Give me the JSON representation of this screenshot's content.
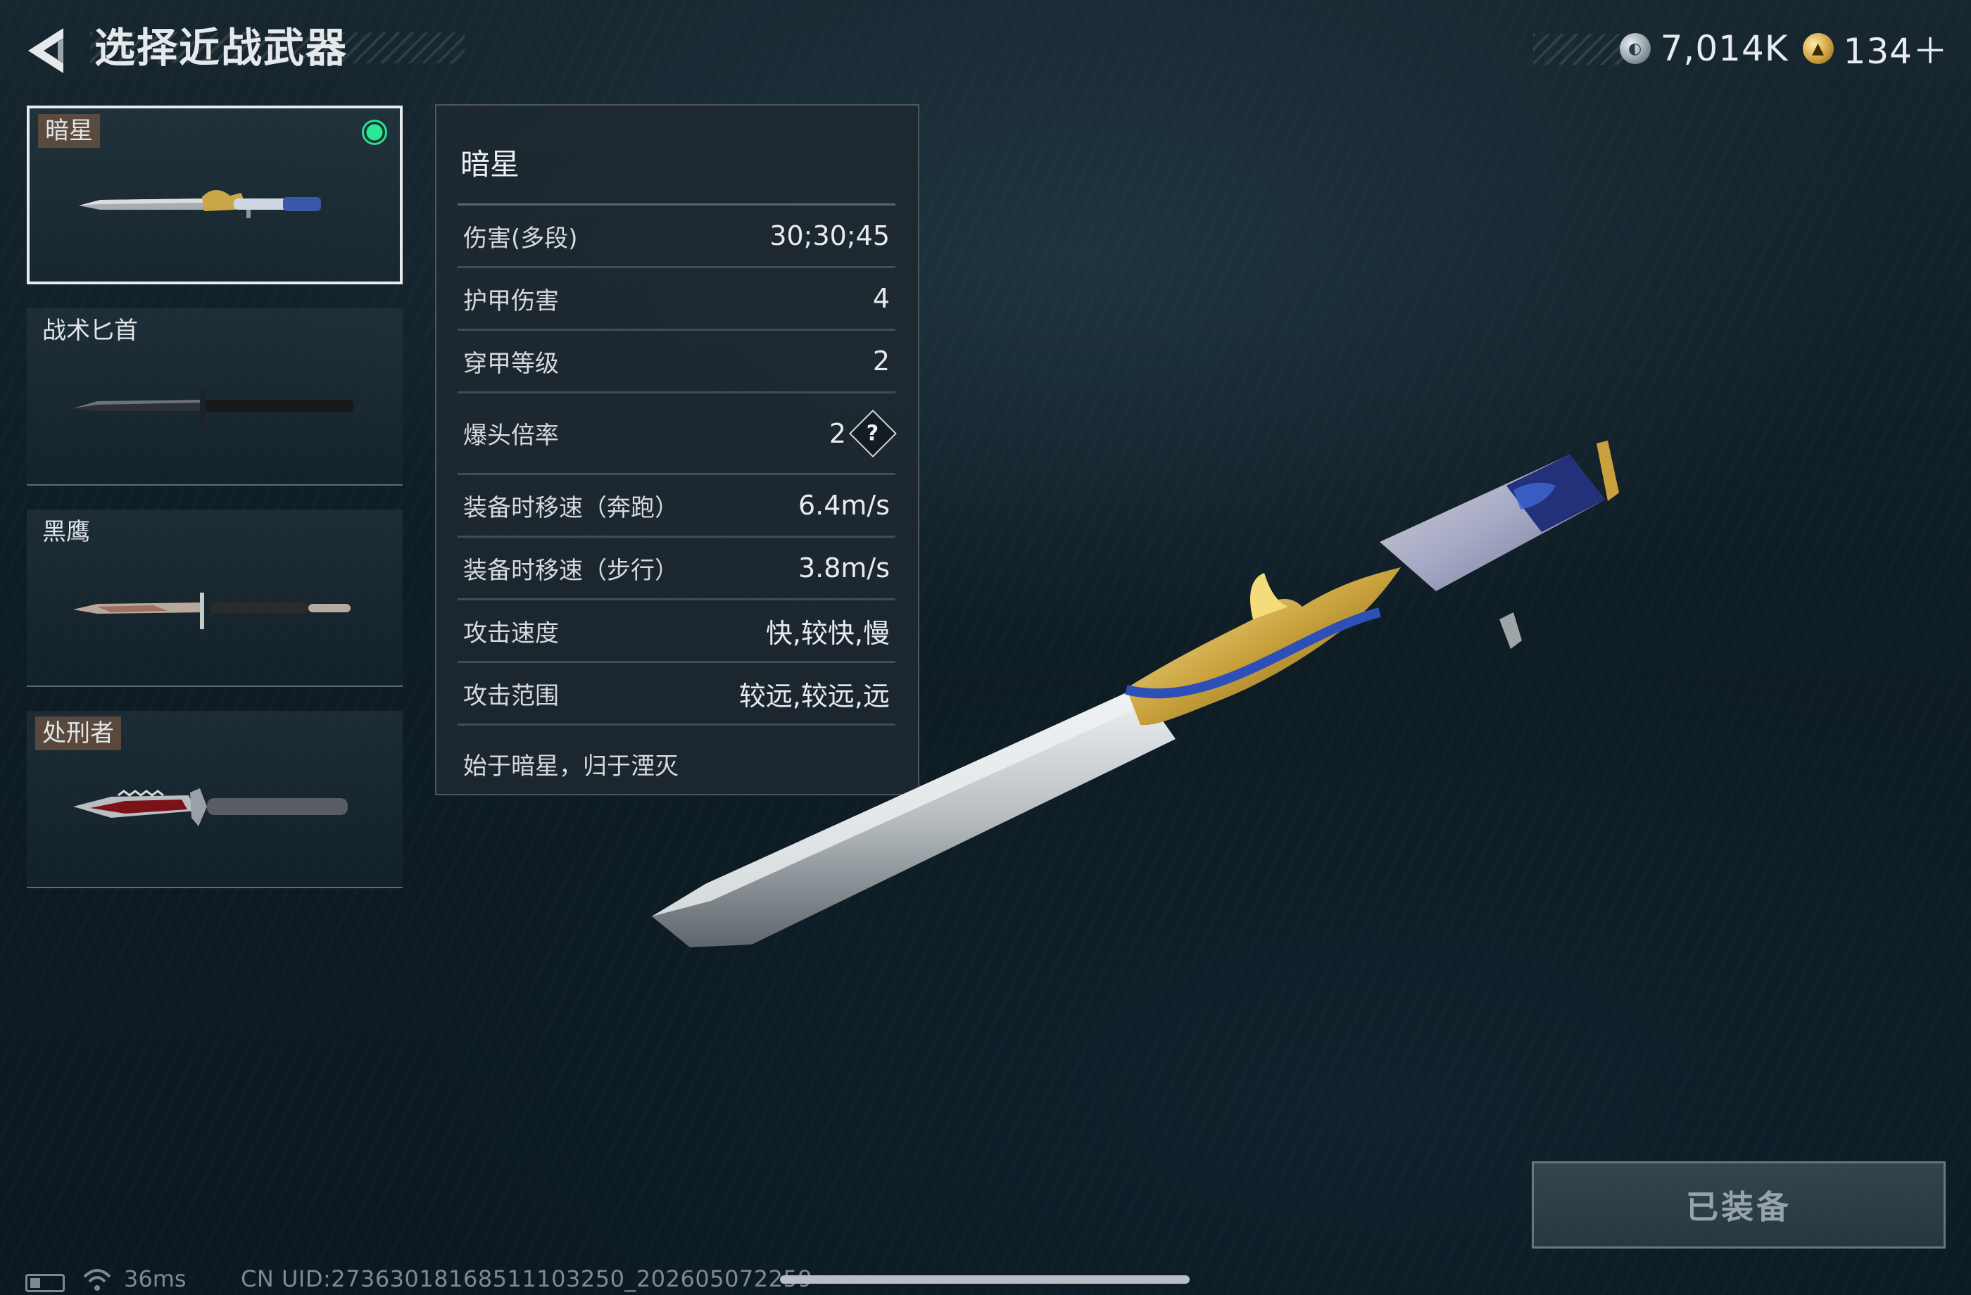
{
  "header": {
    "title": "选择近战武器",
    "back_icon": "back-arrow-icon"
  },
  "currencies": [
    {
      "icon": "silver-coin-icon",
      "value": "7,014K"
    },
    {
      "icon": "gold-coin-icon",
      "value": "134＋"
    }
  ],
  "weapon_list": {
    "items": [
      {
        "name": "暗星",
        "selected": true,
        "equipped": true
      },
      {
        "name": "战术匕首",
        "selected": false,
        "equipped": false
      },
      {
        "name": "黑鹰",
        "selected": false,
        "equipped": false
      },
      {
        "name": "处刑者",
        "selected": false,
        "equipped": false
      }
    ]
  },
  "stats": {
    "name": "暗星",
    "rows": [
      {
        "label": "伤害(多段)",
        "value": "30;30;45"
      },
      {
        "label": "护甲伤害",
        "value": "4"
      },
      {
        "label": "穿甲等级",
        "value": "2"
      },
      {
        "label": "爆头倍率",
        "value": "2"
      },
      {
        "label": "装备时移速（奔跑）",
        "value": "6.4m/s"
      },
      {
        "label": "装备时移速（步行）",
        "value": "3.8m/s"
      },
      {
        "label": "攻击速度",
        "value": "快,较快,慢"
      },
      {
        "label": "攻击范围",
        "value": "较远,较远,远"
      }
    ],
    "help_symbol": "?",
    "description": "始于暗星，归于湮灭"
  },
  "equip_button": {
    "label": "已装备"
  },
  "footer": {
    "latency": "36ms",
    "uid": "CN UID:2736301816851110325​0_20260507225​9"
  },
  "colors": {
    "background": "#0e1c24",
    "equipped_dot": "#29e896",
    "card_tag": "#6e5440",
    "panel": "#1e2830"
  }
}
